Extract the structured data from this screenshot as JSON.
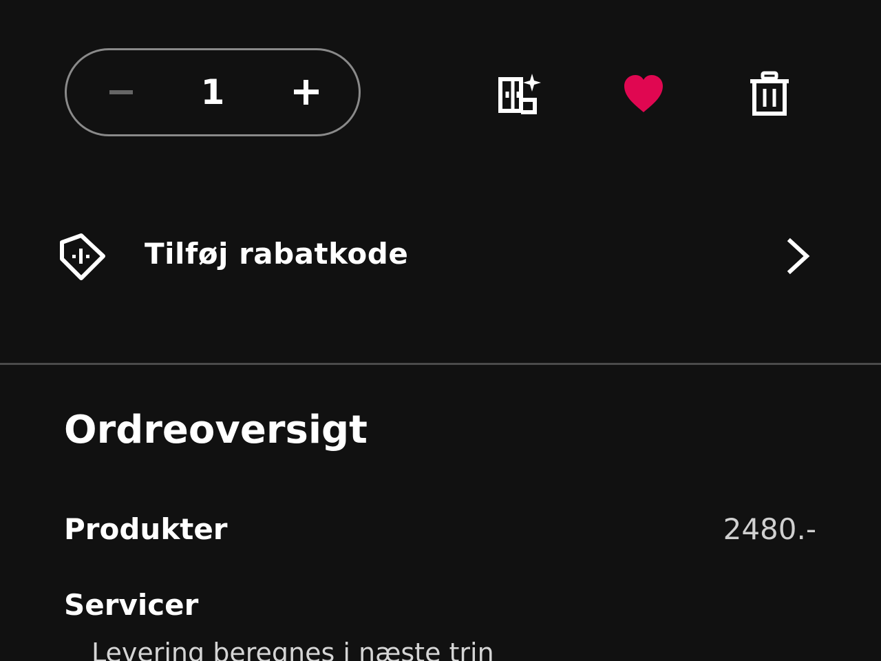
{
  "cart_item": {
    "quantity": "1",
    "icons": {
      "decrease": "minus-icon",
      "increase": "plus-icon",
      "compare": "compare-sparkle-icon",
      "favorite": "heart-icon",
      "delete": "trash-icon"
    },
    "colors": {
      "favorite_active": "#E00751",
      "disabled_minus": "#666666"
    }
  },
  "discount": {
    "label": "Tilføj rabatkode",
    "icon": "discount-tag-icon",
    "chevron": "chevron-right-icon"
  },
  "order_summary": {
    "title": "Ordreoversigt",
    "products": {
      "label": "Produkter",
      "value": "2480.-"
    },
    "services": {
      "label": "Servicer",
      "note": "Levering beregnes i næste trin"
    }
  },
  "theme": {
    "background": "#111111",
    "text": "#FFFFFF",
    "divider": "#4B4B4B",
    "muted_text": "#D0D0D0"
  }
}
